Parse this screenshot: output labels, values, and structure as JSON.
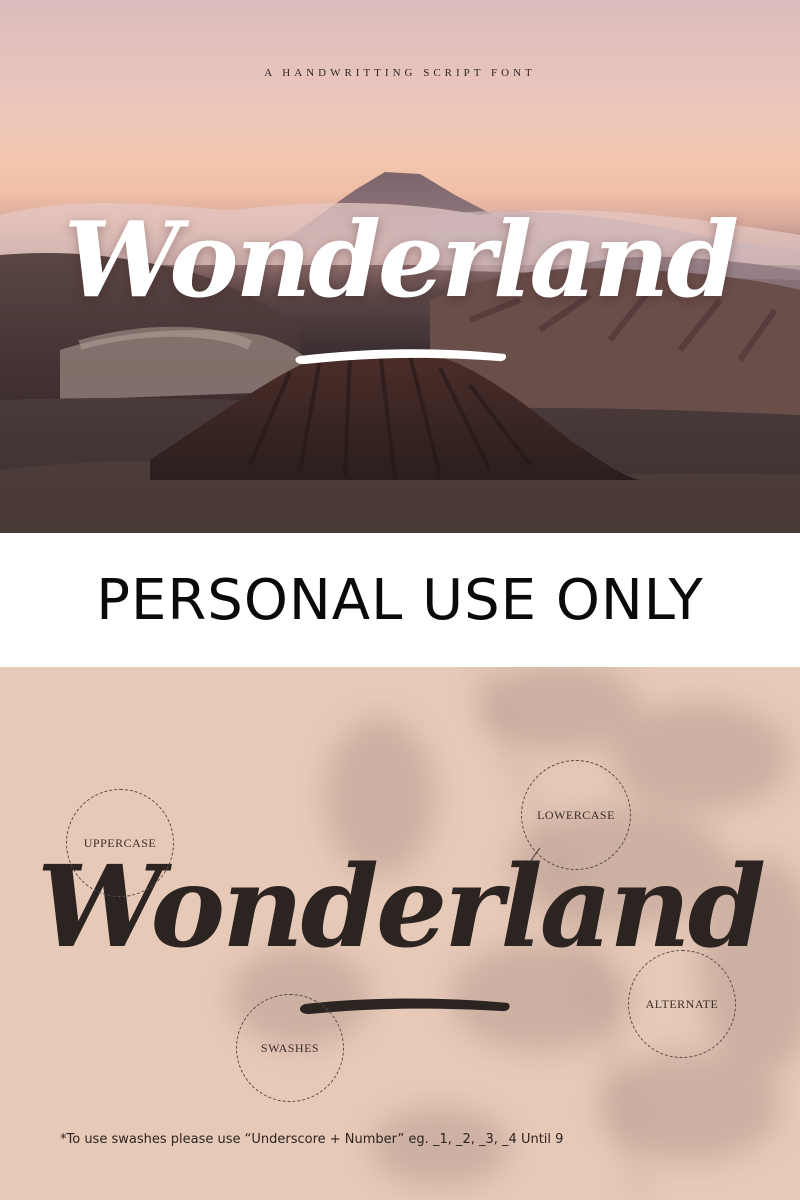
{
  "hero": {
    "tagline": "A HANDWRITTING SCRIPT FONT",
    "title": "Wonderland"
  },
  "banner": {
    "text": "PERSONAL USE ONLY"
  },
  "specimen": {
    "title": "Wonderland",
    "features": {
      "uppercase": "UPPERCASE",
      "lowercase": "LOWERCASE",
      "alternate": "ALTERNATE",
      "swashes": "SWASHES"
    },
    "footnote": "*To use swashes please use “Underscore + Number” eg. _1, _2, _3, _4 Until 9"
  },
  "colors": {
    "sky_top": "#dcbcbd",
    "sky_glow": "#f2c6ae",
    "specimen_bg": "#e7c9b8",
    "script_dark": "#2c2420",
    "script_light": "#ffffff"
  }
}
